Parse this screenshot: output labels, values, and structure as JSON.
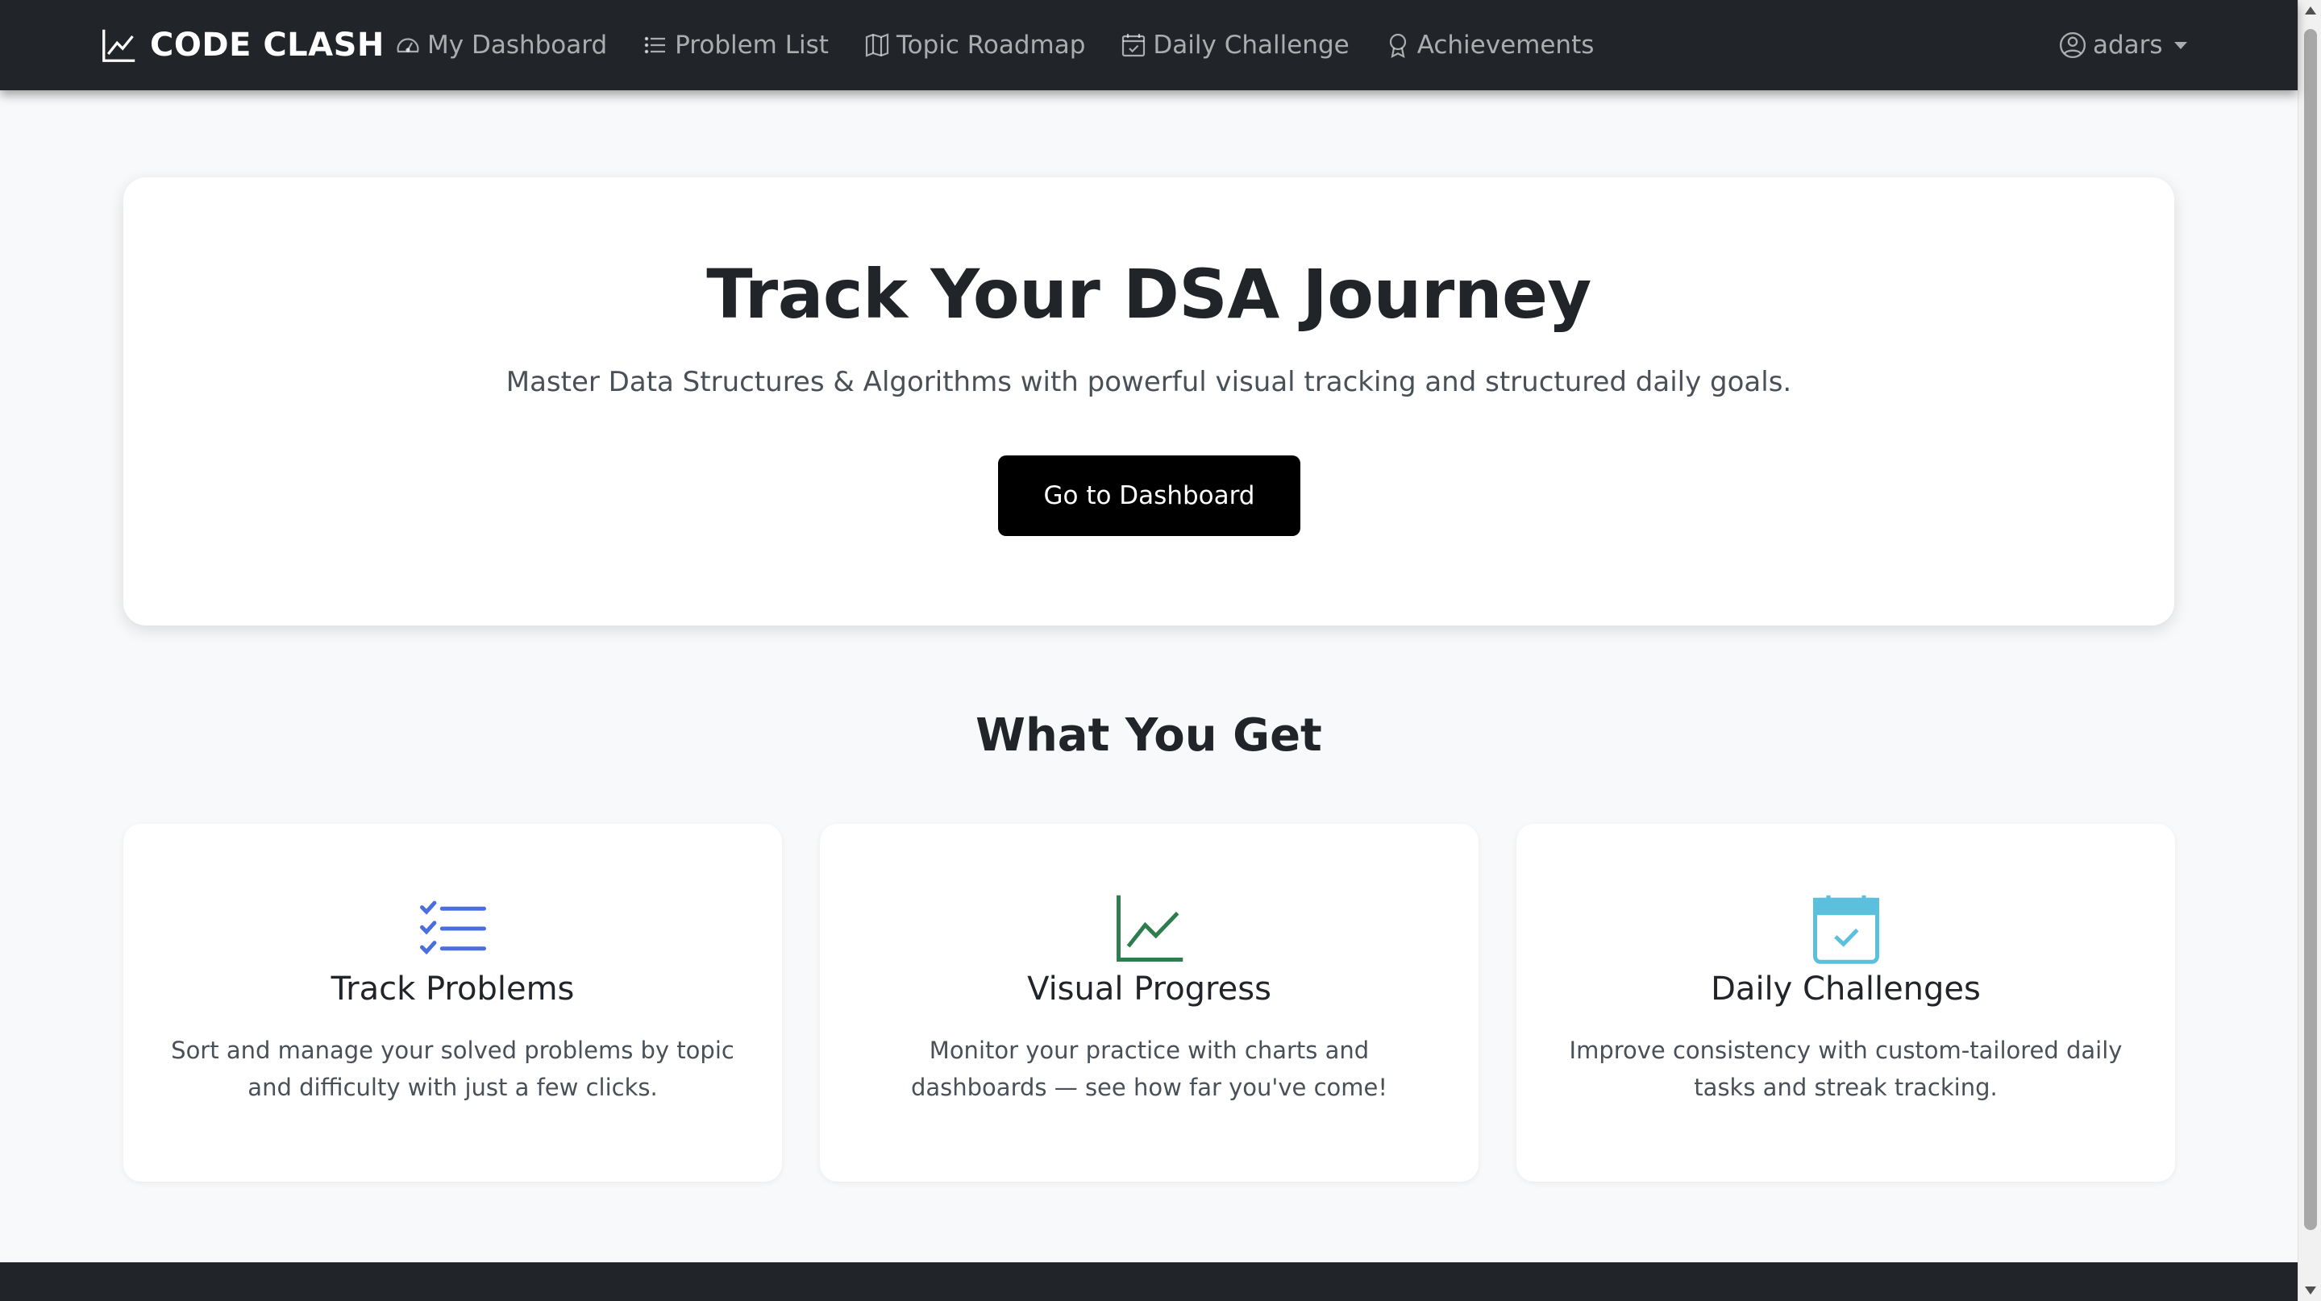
{
  "navbar": {
    "brand": "CODE CLASH",
    "links": [
      {
        "label": "My Dashboard",
        "icon": "speedometer-icon"
      },
      {
        "label": "Problem List",
        "icon": "list-icon"
      },
      {
        "label": "Topic Roadmap",
        "icon": "map-icon"
      },
      {
        "label": "Daily Challenge",
        "icon": "calendar-check-icon"
      },
      {
        "label": "Achievements",
        "icon": "award-icon"
      }
    ],
    "user": "adars"
  },
  "hero": {
    "title": "Track Your DSA Journey",
    "subtitle": "Master Data Structures & Algorithms with powerful visual tracking and structured daily goals.",
    "cta": "Go to Dashboard"
  },
  "features": {
    "title": "What You Get",
    "cards": [
      {
        "title": "Track Problems",
        "text": "Sort and manage your solved problems by topic and difficulty with just a few clicks.",
        "icon": "list-check-icon",
        "color": "#4a6ee0"
      },
      {
        "title": "Visual Progress",
        "text": "Monitor your practice with charts and dashboards — see how far you've come!",
        "icon": "graph-up-icon",
        "color": "#2e7d4f"
      },
      {
        "title": "Daily Challenges",
        "text": "Improve consistency with custom-tailored daily tasks and streak tracking.",
        "icon": "calendar-check-icon",
        "color": "#5bc0de"
      }
    ]
  },
  "colors": {
    "navbar": "#212529",
    "page_bg": "#f8f9fa",
    "cta_bg": "#000000"
  }
}
